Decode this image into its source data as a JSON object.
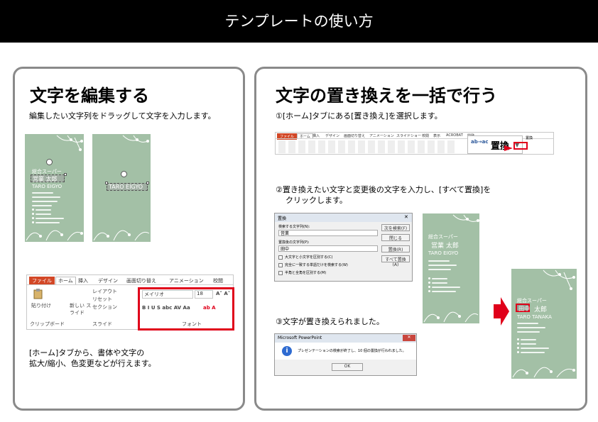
{
  "header": {
    "title": "テンプレートの使い方"
  },
  "left": {
    "heading": "文字を編集する",
    "instruction": "編集したい文字列をドラッグして文字を入力します。",
    "card": {
      "dept": "総合スーパー",
      "name_selected": "営業 太郎",
      "name_roman": "TARO EIGYO",
      "name_roman_selected": "TARO EIGYO",
      "company": "総合スーパー",
      "address_block": "000-0000 ○○県○○市○○町○○"
    },
    "ribbon": {
      "tabs": [
        "ファイル",
        "ホーム",
        "挿入",
        "デザイン",
        "画面切り替え",
        "アニメーション",
        "校閲"
      ],
      "font_name": "メイリオ",
      "font_size": "18",
      "group_clipboard": "クリップボード",
      "group_slides": "スライド",
      "group_font": "フォント",
      "paste": "貼り付け",
      "new_slide": "新しい スライド",
      "layout": "レイアウト",
      "reset": "リセット",
      "section": "セクション"
    },
    "note_line1": "[ホーム]タブから、書体や文字の",
    "note_line2": "拡大/縮小、色変更などが行えます。"
  },
  "right": {
    "heading": "文字の置き換えを一括で行う",
    "step1": "①[ホーム]タブにある[置き換え]を選択します。",
    "ribbon": {
      "tabs": [
        "ファイル",
        "ホーム",
        "挿入",
        "デザイン",
        "画面切り替え",
        "アニメーション",
        "スライドショー",
        "校閲",
        "表示",
        "ACROBAT",
        "開発"
      ],
      "replace_label": "置換",
      "replace_menu_item": "置換"
    },
    "step2_line1": "②置き換えたい文字と変更後の文字を入力し、[すべて置換]を",
    "step2_line2": "クリックします。",
    "dialog": {
      "title": "置換",
      "find_label": "検索する文字列(N):",
      "find_value": "営業",
      "replace_label": "置換後の文字列(P):",
      "replace_value": "田中",
      "btn_find_next": "次を検索(F)",
      "btn_close": "閉じる",
      "btn_replace": "置換(R)",
      "btn_replace_all": "すべて置換(A)",
      "opt1": "大文字と小文字を区別する(C)",
      "opt2": "完全に一致する単語だけを検索する(W)",
      "opt3": "半角と全角を区別する(M)"
    },
    "card_before": {
      "dept": "総合スーパー",
      "name": "営業 太郎",
      "roman": "TARO EIGYO"
    },
    "card_after": {
      "dept": "総合スーパー",
      "name_selected": "田中",
      "name_rest": "太郎",
      "roman": "TARO TANAKA"
    },
    "step3": "③文字が置き換えられました。",
    "msgbox": {
      "title": "Microsoft PowerPoint",
      "message": "プレゼンテーションの検索が終了し、10 個の置換が行われました。",
      "ok": "OK"
    },
    "colors": {
      "accent_red": "#e0001a",
      "card_green": "#a3c0a6"
    }
  }
}
